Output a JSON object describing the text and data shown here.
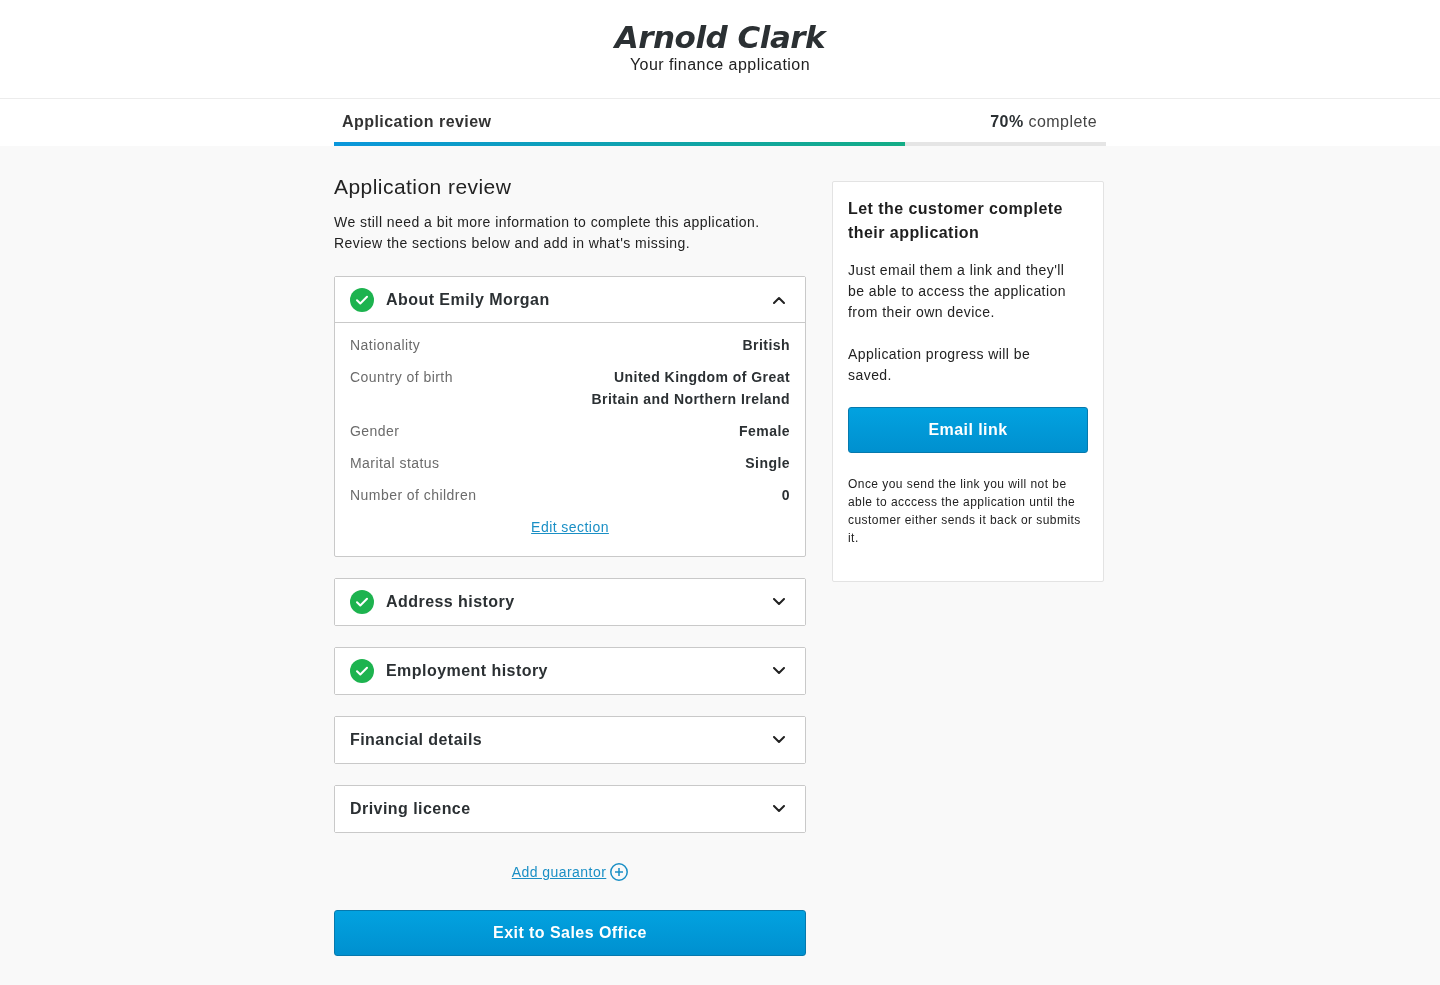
{
  "header": {
    "logo": "Arnold Clark",
    "subtitle": "Your finance application"
  },
  "progress": {
    "step": "Application review",
    "status": "**70%** complete",
    "level": 0.74
  },
  "main": {
    "title": "Application review",
    "intro": "We still need a bit more information to complete this application. Review the sections below and add in what's missing.",
    "sections": [
      {
        "title": "About Emily Morgan",
        "complete": true,
        "expanded": true,
        "fields": [
          {
            "label": "Nationality",
            "value": "British"
          },
          {
            "label": "Country of birth",
            "value": "United Kingdom of Great Britain and Northern Ireland"
          },
          {
            "label": "Gender",
            "value": "Female"
          },
          {
            "label": "Marital status",
            "value": "Single"
          },
          {
            "label": "Number of children",
            "value": "0"
          }
        ],
        "edit_link": "Edit section"
      },
      {
        "title": "Address history",
        "complete": true,
        "expanded": false
      },
      {
        "title": "Employment history",
        "complete": true,
        "expanded": false
      },
      {
        "title": "Financial details",
        "complete": false,
        "expanded": false
      },
      {
        "title": "Driving licence",
        "complete": false,
        "expanded": false
      }
    ],
    "add_guarantor": "Add guarantor",
    "exit_button": "Exit to Sales Office"
  },
  "sidebar": {
    "title": "Let the customer complete their application",
    "paragraphs": [
      "Just email them a link and they'll be able to access the application from their own device.",
      "Application progress will be saved."
    ],
    "button": "Email link",
    "note": "Once you send the link you will not be able to acccess the application until the customer either sends it back or submits it."
  }
}
